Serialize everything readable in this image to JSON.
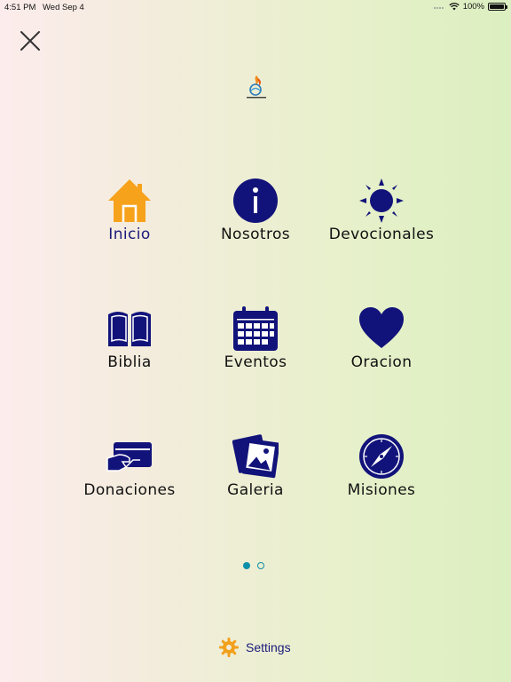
{
  "status_bar": {
    "time": "4:51 PM",
    "date": "Wed Sep 4",
    "battery": "100%",
    "battery_level": 1.0
  },
  "close_icon": "close-icon",
  "logo": {
    "name": "church-logo"
  },
  "menu": {
    "items": [
      {
        "label": "Inicio",
        "icon": "home-icon",
        "active": true
      },
      {
        "label": "Nosotros",
        "icon": "info-icon"
      },
      {
        "label": "Devocionales",
        "icon": "sun-icon"
      },
      {
        "label": "Biblia",
        "icon": "book-icon"
      },
      {
        "label": "Eventos",
        "icon": "calendar-icon"
      },
      {
        "label": "Oracion",
        "icon": "heart-icon"
      },
      {
        "label": "Donaciones",
        "icon": "donation-card-icon"
      },
      {
        "label": "Galeria",
        "icon": "photos-icon"
      },
      {
        "label": "Misiones",
        "icon": "compass-icon"
      }
    ]
  },
  "pagination": {
    "pages": 2,
    "current": 1
  },
  "settings": {
    "label": "Settings",
    "icon": "gear-icon"
  },
  "colors": {
    "accent": "#1a1a7a",
    "home": "#f7a21b",
    "dot": "#0f8fa8",
    "gear": "#f2a01b"
  }
}
